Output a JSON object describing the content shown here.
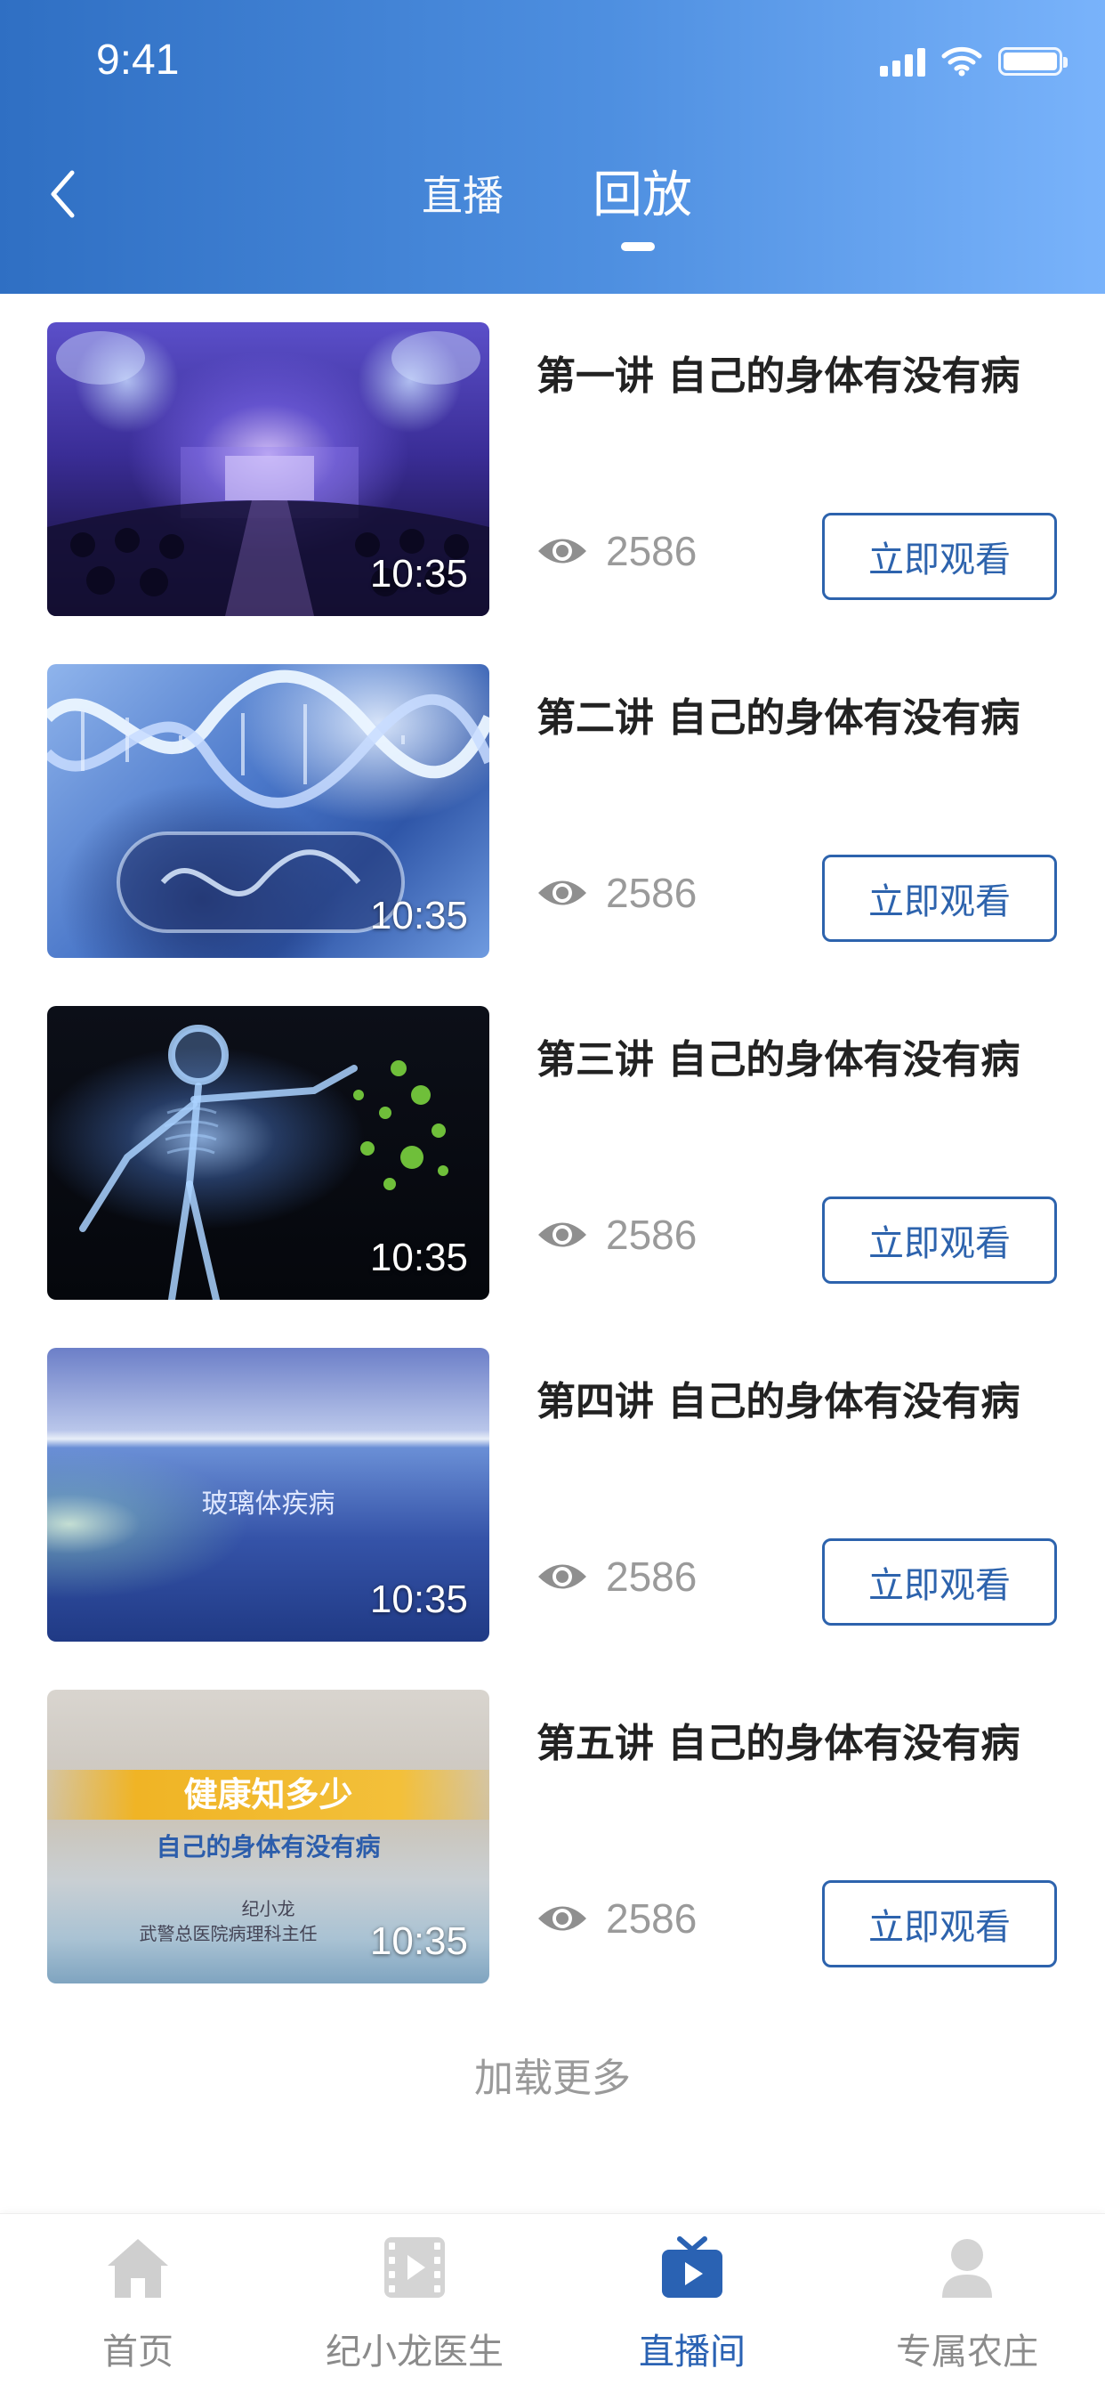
{
  "status_bar": {
    "time": "9:41"
  },
  "header": {
    "tabs": [
      {
        "label": "直播",
        "active": false
      },
      {
        "label": "回放",
        "active": true
      }
    ]
  },
  "videos": [
    {
      "title": "第一讲 自己的身体有没有病",
      "duration": "10:35",
      "views": "2586",
      "button": "立即观看",
      "thumbnail": "conference-hall"
    },
    {
      "title": "第二讲 自己的身体有没有病",
      "duration": "10:35",
      "views": "2586",
      "button": "立即观看",
      "thumbnail": "dna-helix"
    },
    {
      "title": "第三讲 自己的身体有没有病",
      "duration": "10:35",
      "views": "2586",
      "button": "立即观看",
      "thumbnail": "skeleton-virus"
    },
    {
      "title": "第四讲 自己的身体有没有病",
      "duration": "10:35",
      "views": "2586",
      "button": "立即观看",
      "thumbnail": "ocean-horizon",
      "overlay_text": "玻璃体疾病"
    },
    {
      "title": "第五讲 自己的身体有没有病",
      "duration": "10:35",
      "views": "2586",
      "button": "立即观看",
      "thumbnail": "health-banner",
      "overlay": {
        "title": "健康知多少",
        "subtitle": "自己的身体有没有病",
        "name": "纪小龙",
        "role": "武警总医院病理科主任"
      }
    }
  ],
  "load_more": "加载更多",
  "tabbar": {
    "items": [
      {
        "label": "首页",
        "icon": "home-icon",
        "active": false
      },
      {
        "label": "纪小龙医生",
        "icon": "video-icon",
        "active": false
      },
      {
        "label": "直播间",
        "icon": "live-tv-icon",
        "active": true
      },
      {
        "label": "专属农庄",
        "icon": "person-icon",
        "active": false
      }
    ]
  },
  "colors": {
    "header_gradient_start": "#2f6fc3",
    "header_gradient_end": "#79b3fb",
    "accent": "#2d63ad",
    "muted_text": "#9a9a9a"
  }
}
